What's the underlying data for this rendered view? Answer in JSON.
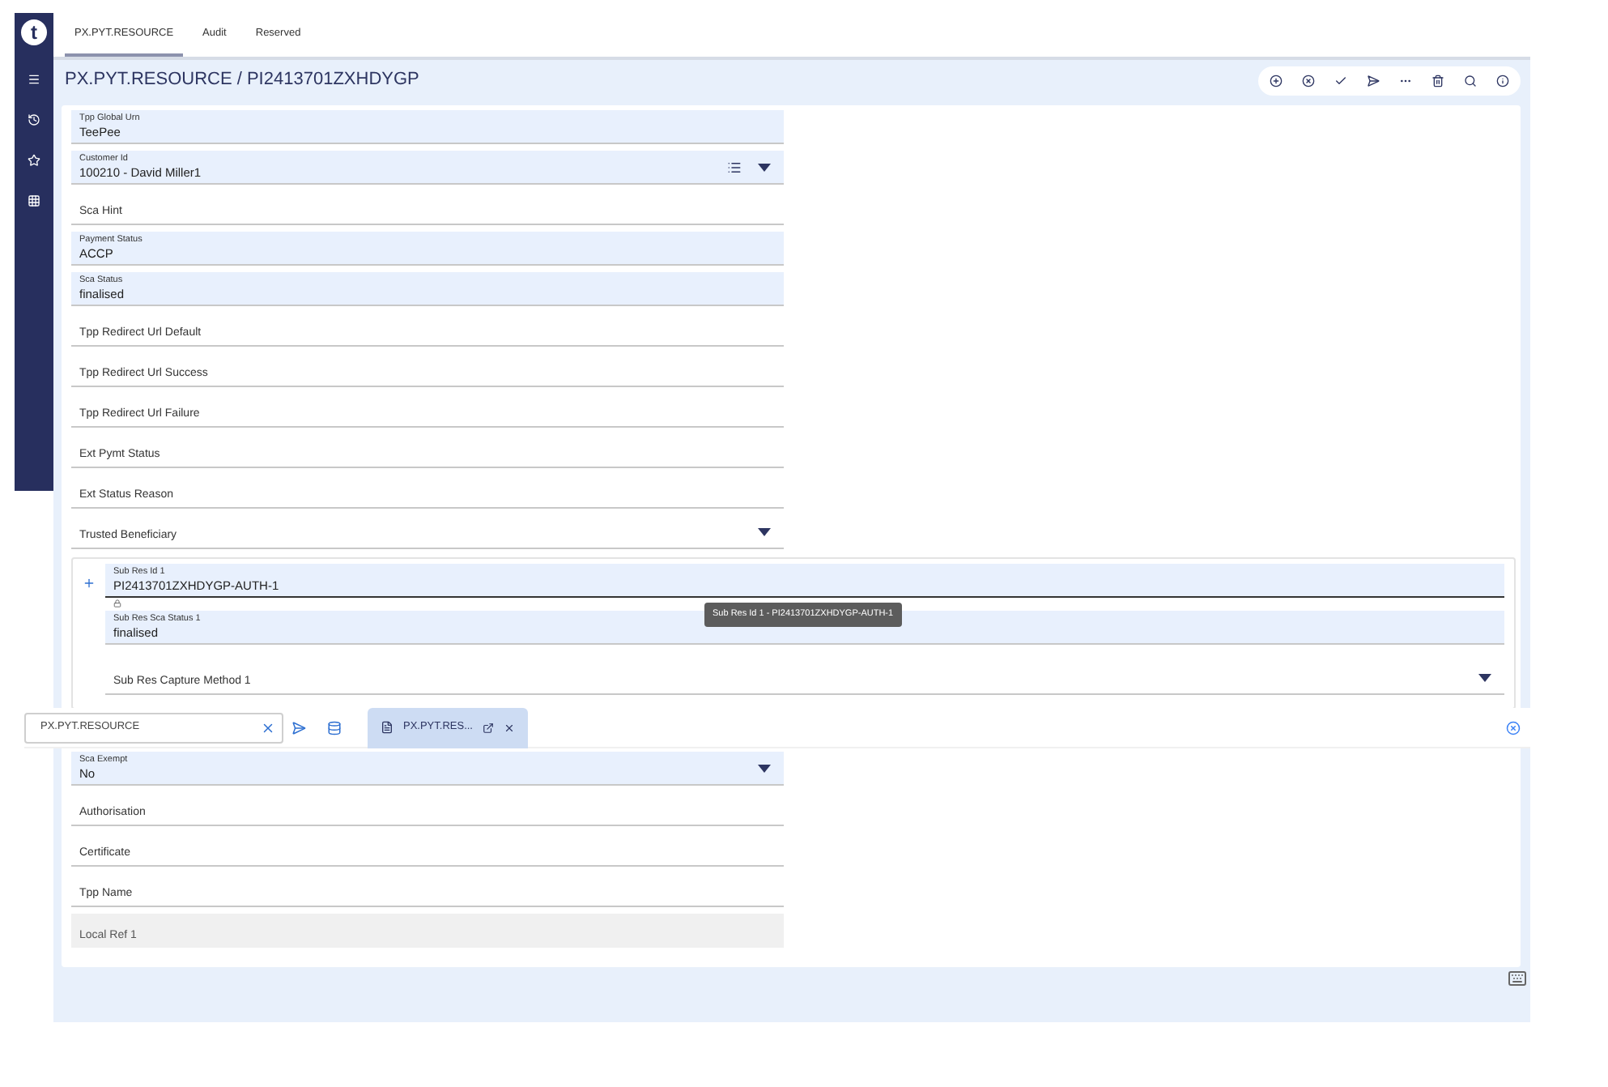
{
  "logo": "t",
  "sidebar": {
    "items": [
      {
        "kind": "menu"
      },
      {
        "kind": "history"
      },
      {
        "kind": "star"
      },
      {
        "kind": "grid"
      }
    ]
  },
  "tabs": [
    {
      "label": "PX.PYT.RESOURCE",
      "selected": true
    },
    {
      "label": "Audit",
      "selected": false
    },
    {
      "label": "Reserved",
      "selected": false
    }
  ],
  "header": {
    "title": "PX.PYT.RESOURCE / PI2413701ZXHDYGP",
    "toolbar": [
      {
        "kind": "add"
      },
      {
        "kind": "cancel"
      },
      {
        "kind": "validate"
      },
      {
        "kind": "commit"
      },
      {
        "kind": "more"
      },
      {
        "kind": "delete"
      },
      {
        "kind": "search"
      },
      {
        "kind": "info"
      }
    ]
  },
  "fields": [
    {
      "label": "Tpp Global Urn",
      "value": "TeePee",
      "kind": "filled",
      "dropdown": false,
      "list": false
    },
    {
      "label": "Customer Id",
      "value": "100210 - David Miller1",
      "kind": "filled",
      "dropdown": true,
      "list": true
    },
    {
      "label": "Sca Hint",
      "kind": "empty",
      "dropdown": false,
      "list": false
    },
    {
      "label": "Payment Status",
      "value": "ACCP",
      "kind": "filled",
      "dropdown": false,
      "list": false
    },
    {
      "label": "Sca Status",
      "value": "finalised",
      "kind": "filled",
      "dropdown": false,
      "list": false
    },
    {
      "label": "Tpp Redirect Url Default",
      "kind": "empty",
      "dropdown": false,
      "list": false
    },
    {
      "label": "Tpp Redirect Url Success",
      "kind": "empty",
      "dropdown": false,
      "list": false
    },
    {
      "label": "Tpp Redirect Url Failure",
      "kind": "empty",
      "dropdown": false,
      "list": false
    },
    {
      "label": "Ext Pymt Status",
      "kind": "empty",
      "dropdown": false,
      "list": false
    },
    {
      "label": "Ext Status Reason",
      "kind": "empty",
      "dropdown": false,
      "list": false
    },
    {
      "label": "Trusted Beneficiary",
      "kind": "empty",
      "dropdown": true,
      "list": false
    }
  ],
  "sub_resource": {
    "fields": [
      {
        "label": "Sub Res Id 1",
        "value": "PI2413701ZXHDYGP-AUTH-1",
        "kind": "filled",
        "dropdown": false,
        "focused": true
      },
      {
        "label": "Sub Res Sca Status 1",
        "value": "finalised",
        "kind": "filled",
        "dropdown": false,
        "focused": false
      },
      {
        "label": "Sub Res Capture Method 1",
        "kind": "empty",
        "dropdown": true,
        "focused": false
      }
    ],
    "tooltip": "Sub Res Id 1 - PI2413701ZXHDYGP-AUTH-1"
  },
  "fields_after": [
    {
      "label": "Sca Exempt",
      "value": "No",
      "kind": "filled",
      "dropdown": true,
      "list": false
    },
    {
      "label": "Authorisation",
      "kind": "empty",
      "dropdown": false,
      "list": false
    },
    {
      "label": "Certificate",
      "kind": "empty",
      "dropdown": false,
      "list": false
    },
    {
      "label": "Tpp Name",
      "kind": "empty",
      "dropdown": false,
      "list": false
    },
    {
      "label": "Local Ref 1",
      "kind": "disabled",
      "dropdown": false,
      "list": false
    }
  ],
  "command_bar": {
    "value": "PX.PYT.RESOURCE",
    "tabs": [
      {
        "label": "PX.PYT.RES...",
        "selected": true
      }
    ]
  }
}
